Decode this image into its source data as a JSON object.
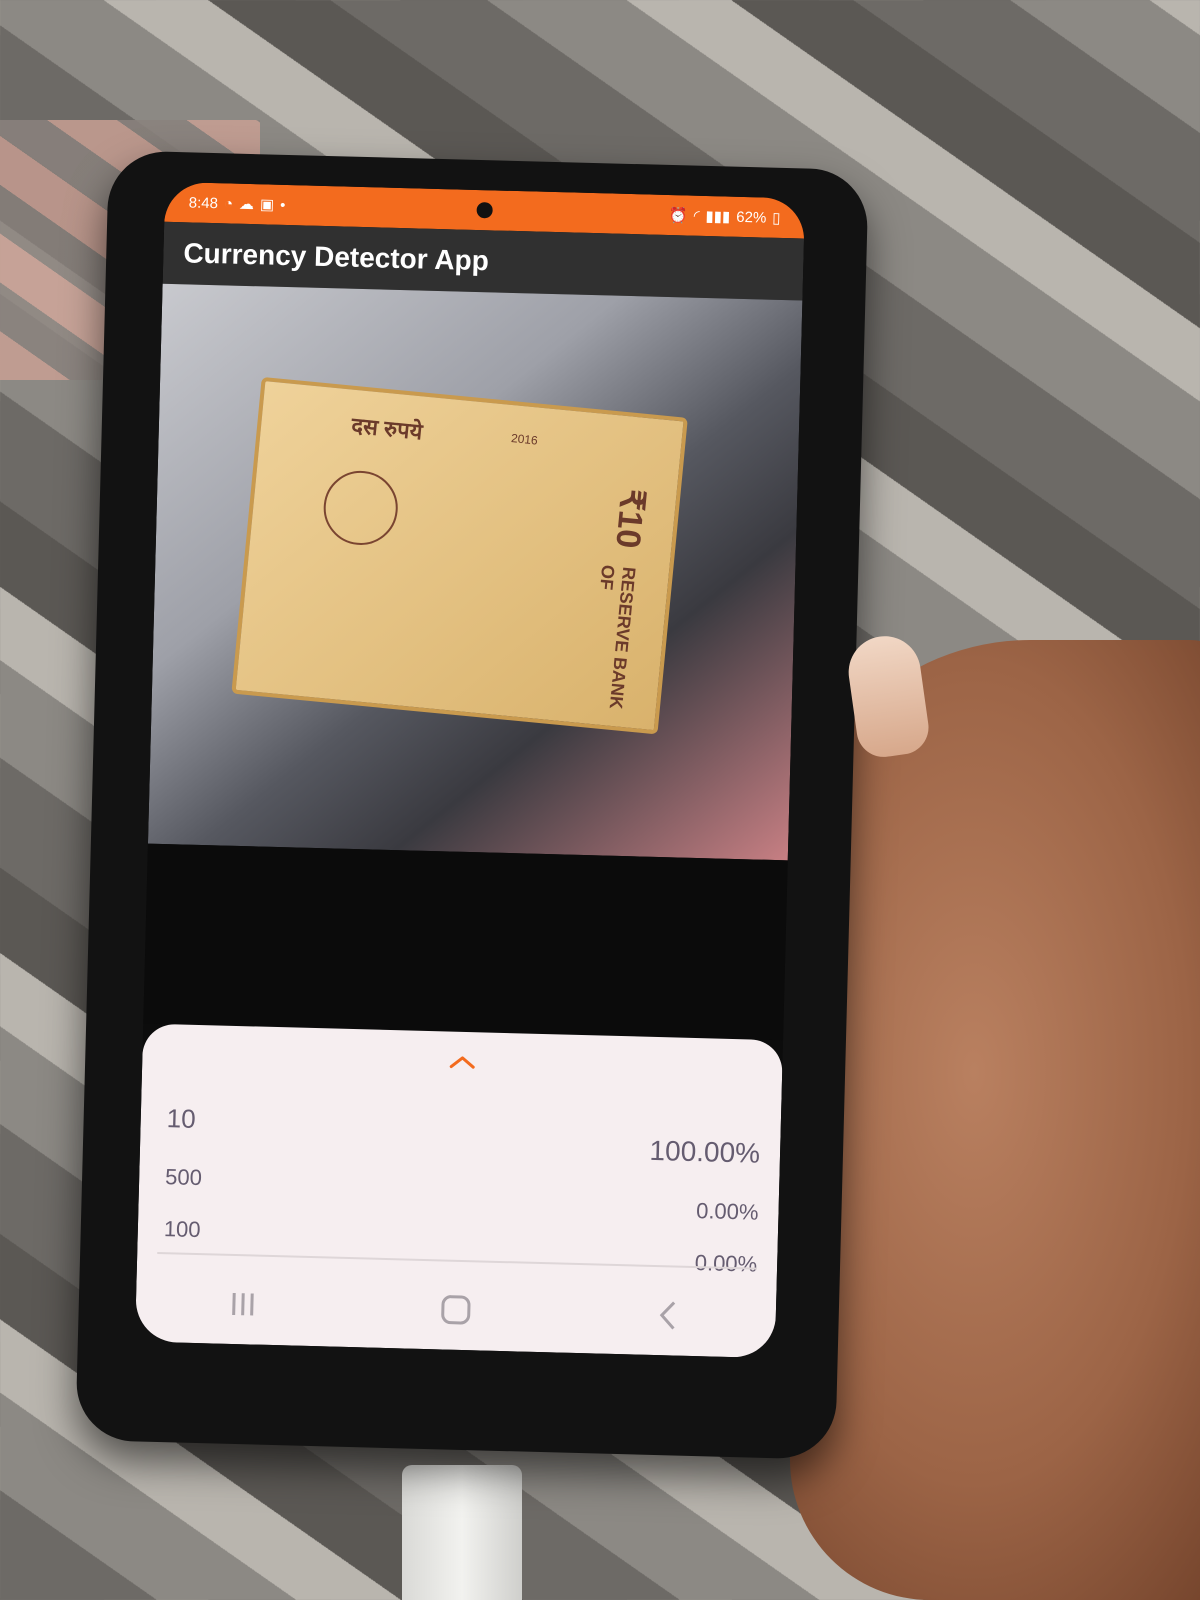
{
  "status_bar": {
    "time": "8:48",
    "battery": "62%"
  },
  "app_bar": {
    "title": "Currency Detector App"
  },
  "banknote": {
    "top_text": "दस रुपये",
    "year": "2016",
    "denomination": "₹10",
    "bank": "RESERVE BANK OF"
  },
  "results": [
    {
      "label": "10",
      "value": "100.00%"
    },
    {
      "label": "500",
      "value": "0.00%"
    },
    {
      "label": "100",
      "value": "0.00%"
    }
  ],
  "colors": {
    "status_bar": "#f36b1e",
    "app_bar": "#303030",
    "sheet_bg": "#f6eef0",
    "accent": "#f36b1e"
  },
  "icons": {
    "expand": "chevron-up-icon",
    "nav": [
      "recents-icon",
      "home-icon",
      "back-icon"
    ]
  }
}
